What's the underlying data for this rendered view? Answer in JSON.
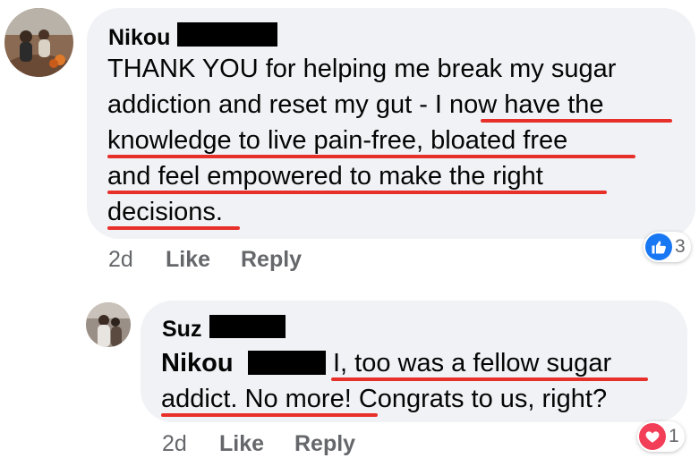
{
  "comments": [
    {
      "author": "Nikou",
      "lines": [
        "THANK YOU for helping me break my sugar",
        "addiction and reset my gut - I now have the",
        "knowledge to live pain-free, bloated free",
        "and feel empowered to make the right",
        "decisions."
      ],
      "time": "2d",
      "like_label": "Like",
      "reply_label": "Reply",
      "reaction": {
        "icon": "thumbs-up-icon",
        "count": "3",
        "color": "#1877f2"
      }
    },
    {
      "author": "Suz",
      "mention": "Nikou",
      "lines": [
        "I, too was a fellow sugar",
        "addict. No more! Congrats to us, right?"
      ],
      "time": "2d",
      "like_label": "Like",
      "reply_label": "Reply",
      "reaction": {
        "icon": "heart-icon",
        "count": "1",
        "color": "#f33e58"
      }
    }
  ],
  "colors": {
    "underline": "#e8302a",
    "bubble": "#f0f2f5",
    "meta": "#65676b"
  }
}
